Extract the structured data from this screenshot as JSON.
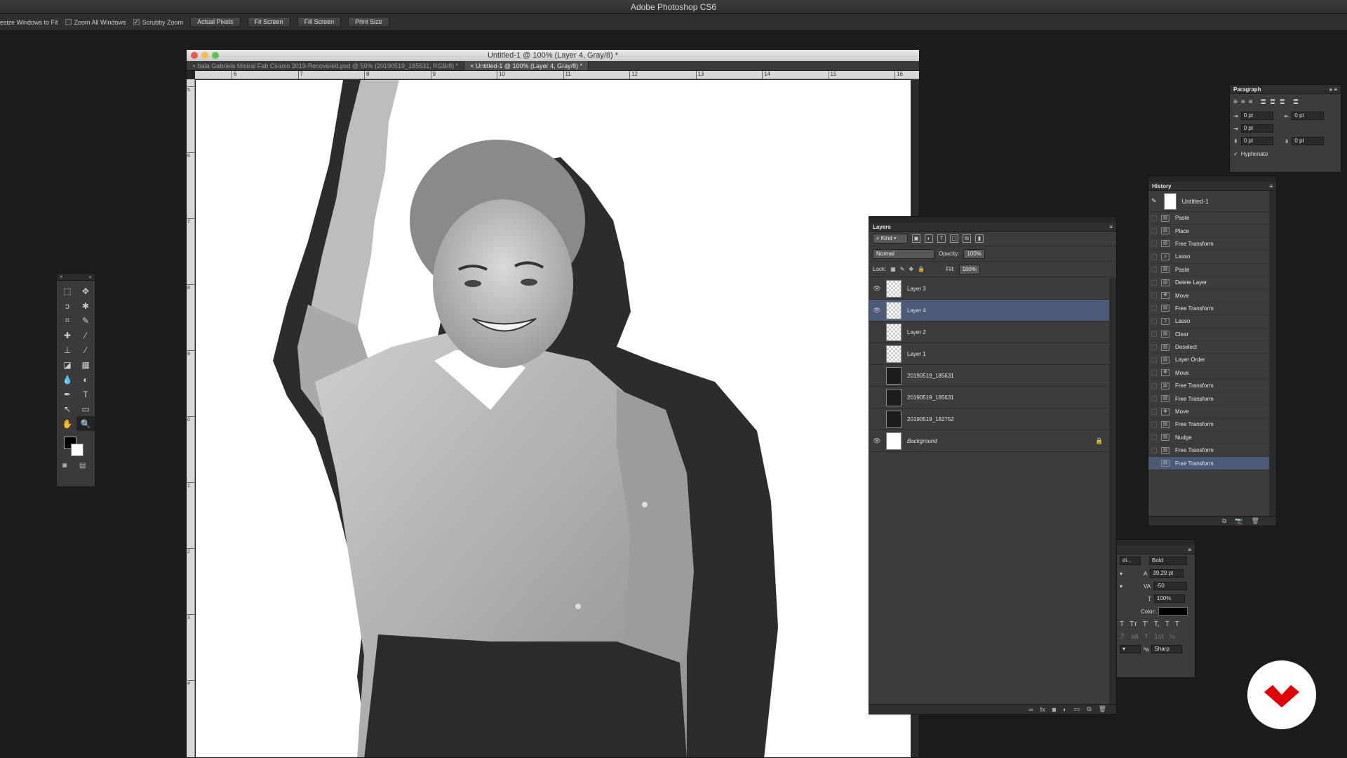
{
  "app": {
    "title": "Adobe Photoshop CS6"
  },
  "options_bar": {
    "checkboxes": [
      {
        "label": "esize Windows to Fit",
        "checked": false
      },
      {
        "label": "Zoom All Windows",
        "checked": false
      },
      {
        "label": "Scrubby Zoom",
        "checked": true
      }
    ],
    "buttons": [
      "Actual Pixels",
      "Fit Screen",
      "Fill Screen",
      "Print Size"
    ]
  },
  "document": {
    "window_title": "Untitled-1 @ 100% (Layer 4, Gray/8) *",
    "tabs": [
      {
        "label": "bala Gabriela Mistral Fab Ciraolo 2019-Recovered.psd @ 50% (20190519_185631, RGB/8) *",
        "active": false
      },
      {
        "label": "Untitled-1 @ 100% (Layer 4, Gray/8) *",
        "active": true
      }
    ],
    "ruler_h": [
      "6",
      "7",
      "8",
      "9",
      "10",
      "11",
      "12",
      "13",
      "14",
      "15",
      "16"
    ],
    "ruler_v": [
      "5",
      "6",
      "7",
      "8",
      "9",
      "0",
      "1",
      "2",
      "3",
      "4"
    ]
  },
  "tools": {
    "items": [
      "marquee-icon",
      "move-icon",
      "lasso-icon",
      "magic-wand-icon",
      "crop-icon",
      "eyedropper-icon",
      "healing-icon",
      "brush-icon",
      "stamp-icon",
      "history-brush-icon",
      "eraser-icon",
      "gradient-icon",
      "blur-icon",
      "dodge-icon",
      "pen-icon",
      "type-icon",
      "path-select-icon",
      "shape-icon",
      "hand-icon",
      "zoom-icon"
    ],
    "glyphs": [
      "⬚",
      "✥",
      "ↄ",
      "✱",
      "⌗",
      "✎",
      "✚",
      "⁄",
      "⊥",
      "⁄",
      "◪",
      "▦",
      "💧",
      "◐",
      "✒",
      "T",
      "↖",
      "▭",
      "✋",
      "🔍"
    ],
    "fg_color": "#000000",
    "bg_color": "#ffffff"
  },
  "layers_panel": {
    "title": "Layers",
    "filter": "Kind",
    "blend_mode": "Normal",
    "opacity_label": "Opacity:",
    "opacity": "100%",
    "lock_label": "Lock:",
    "fill_label": "Fill:",
    "fill": "100%",
    "layers": [
      {
        "name": "Layer 3",
        "visible": true,
        "selected": false,
        "italic": false
      },
      {
        "name": "Layer 4",
        "visible": true,
        "selected": true,
        "italic": false
      },
      {
        "name": "Layer 2",
        "visible": false,
        "selected": false,
        "italic": false
      },
      {
        "name": "Layer 1",
        "visible": false,
        "selected": false,
        "italic": false
      },
      {
        "name": "20190519_185631",
        "visible": false,
        "selected": false,
        "italic": false
      },
      {
        "name": "20190519_185631",
        "visible": false,
        "selected": false,
        "italic": false
      },
      {
        "name": "20190519_182752",
        "visible": false,
        "selected": false,
        "italic": false
      },
      {
        "name": "Background",
        "visible": true,
        "selected": false,
        "italic": true
      }
    ]
  },
  "history_panel": {
    "title": "History",
    "snapshot": "Untitled-1",
    "items": [
      {
        "label": "Paste",
        "icon": "doc-icon"
      },
      {
        "label": "Place",
        "icon": "doc-icon"
      },
      {
        "label": "Free Transform",
        "icon": "doc-icon"
      },
      {
        "label": "Lasso",
        "icon": "lasso-icon"
      },
      {
        "label": "Paste",
        "icon": "doc-icon"
      },
      {
        "label": "Delete Layer",
        "icon": "doc-icon"
      },
      {
        "label": "Move",
        "icon": "move-icon"
      },
      {
        "label": "Free Transform",
        "icon": "doc-icon"
      },
      {
        "label": "Lasso",
        "icon": "lasso-icon"
      },
      {
        "label": "Clear",
        "icon": "doc-icon"
      },
      {
        "label": "Deselect",
        "icon": "doc-icon"
      },
      {
        "label": "Layer Order",
        "icon": "doc-icon"
      },
      {
        "label": "Move",
        "icon": "move-icon"
      },
      {
        "label": "Free Transform",
        "icon": "doc-icon"
      },
      {
        "label": "Free Transform",
        "icon": "doc-icon"
      },
      {
        "label": "Move",
        "icon": "move-icon"
      },
      {
        "label": "Free Transform",
        "icon": "doc-icon"
      },
      {
        "label": "Nudge",
        "icon": "doc-icon"
      },
      {
        "label": "Free Transform",
        "icon": "doc-icon"
      },
      {
        "label": "Free Transform",
        "icon": "doc-icon",
        "selected": true
      }
    ]
  },
  "paragraph_panel": {
    "title": "Paragraph",
    "indent_left": "0 pt",
    "indent_right": "0 pt",
    "first_line": "0 pt",
    "space_before": "0 pt",
    "space_after": "0 pt",
    "hyphenate_label": "Hyphenate",
    "hyphenate": true
  },
  "character_panel": {
    "font_family": "di...",
    "font_style": "Bold",
    "leading": "39,29 pt",
    "tracking": "-50",
    "scale": "100%",
    "color_label": "Color:",
    "color": "#000000",
    "glyphs_row1": [
      "T",
      "Tт",
      "T'",
      "T,",
      "T",
      "T"
    ],
    "glyphs_row2": [
      "ℱ",
      "aā",
      "T",
      "1st",
      "½"
    ],
    "antialias": "Sharp",
    "aa_label": "ªa"
  },
  "logo": {
    "color": "#e00000"
  }
}
